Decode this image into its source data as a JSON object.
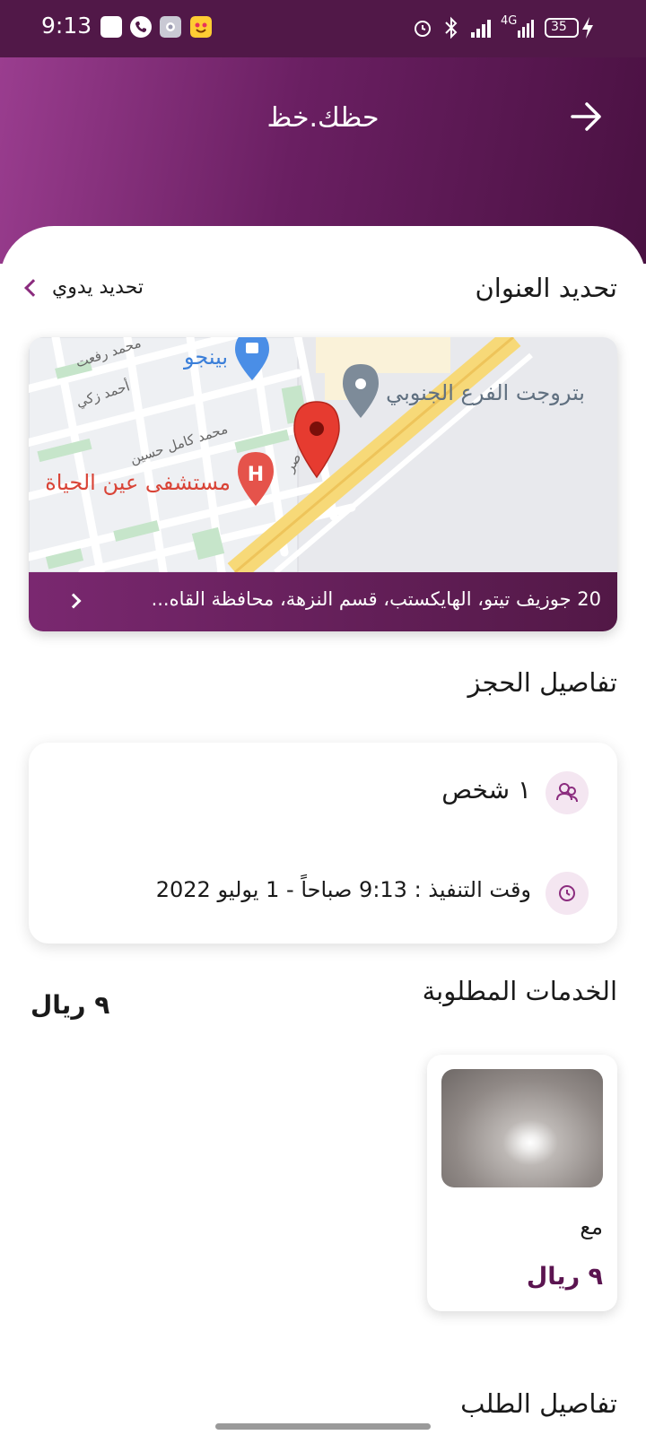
{
  "status_bar": {
    "time": "9:13",
    "battery": "35",
    "network": "4G"
  },
  "header": {
    "title": "حظك.خظ",
    "back_icon": "arrow-right-icon"
  },
  "address_section": {
    "title": "تحديد العنوان",
    "manual_label": "تحديد يدوي",
    "address": "20 جوزيف تيتو، الهايكستب، قسم النزهة، محافظة القاه...",
    "map_labels": {
      "place_1": "بتروجت الفرع الجنوبي",
      "place_2": "بينجو",
      "hospital": "مستشفى عين الحياة",
      "street_1": "محمد رفعت",
      "street_2": "أحمد زكي",
      "street_3": "محمد كامل حسين",
      "street_4": "صر",
      "hospital_marker": "H"
    }
  },
  "booking_section": {
    "title": "تفاصيل الحجز",
    "persons": "١ شخص",
    "execution_time": "وقت التنفيذ : 9:13 صباحاً - 1 يوليو 2022"
  },
  "services_section": {
    "title": "الخدمات المطلوبة",
    "total": "٩ ريال",
    "items": [
      {
        "name": "مع",
        "price": "٩ ريال"
      }
    ]
  },
  "order_section": {
    "title": "تفاصيل الطلب"
  },
  "colors": {
    "primary": "#6a1f62",
    "accent": "#8b2c7e",
    "price": "#5b1450"
  }
}
